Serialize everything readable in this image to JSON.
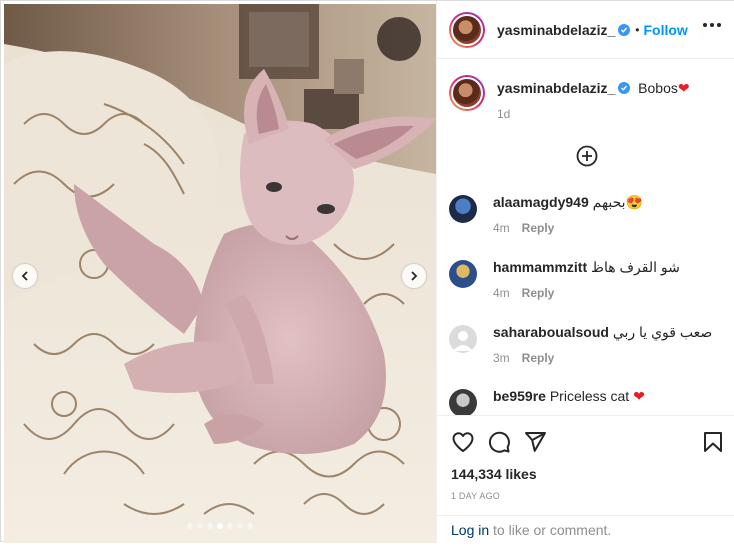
{
  "post": {
    "username": "yasminabdelaziz_",
    "follow_label": "Follow",
    "separator": "•",
    "caption_text": "Bobos",
    "caption_emoji": "❤",
    "caption_time": "1d",
    "likes": "144,334 likes",
    "date": "1 DAY AGO",
    "carousel": {
      "total_slides": 7,
      "active_index": 3
    }
  },
  "comments": [
    {
      "user": "alaamagdy949",
      "text": "بحبهم",
      "emoji": "😍",
      "time": "4m",
      "reply": "Reply"
    },
    {
      "user": "hammammzitt",
      "text": "شو القرف هاظ",
      "emoji": "",
      "time": "4m",
      "reply": "Reply"
    },
    {
      "user": "saharaboualsoud",
      "text": "صعب قوي يا ربي",
      "emoji": "",
      "time": "3m",
      "reply": "Reply"
    },
    {
      "user": "be959re",
      "text": "Priceless cat",
      "emoji": "❤",
      "time": "",
      "reply": ""
    }
  ],
  "footer": {
    "login_link": "Log in",
    "login_rest": " to like or comment."
  },
  "icons": {
    "like": "heart-icon",
    "comment": "comment-icon",
    "share": "share-icon",
    "save": "bookmark-icon",
    "more": "more-icon",
    "load_more": "plus-circle-icon",
    "prev": "chevron-left-icon",
    "next": "chevron-right-icon"
  },
  "colors": {
    "accent": "#0095f6",
    "verified": "#3897f0",
    "muted": "#8e8e8e",
    "text": "#262626"
  }
}
